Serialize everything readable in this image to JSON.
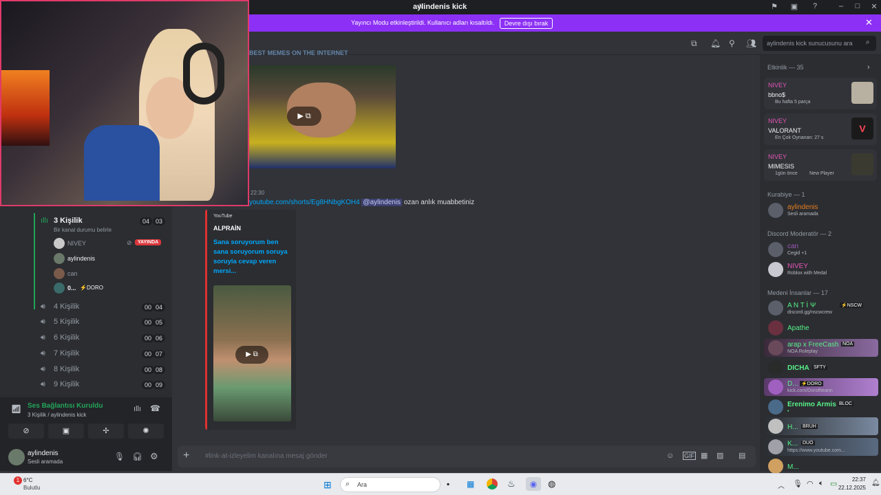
{
  "window": {
    "title": "aylindenis kick"
  },
  "banner": {
    "text": "Yayıncı Modu etkinleştirildi. Kullanıcı adları kısaltıldı.",
    "button": "Devre dışı bırak"
  },
  "header": {
    "search_placeholder": "aylindenis kick sunucusunu ara"
  },
  "chat": {
    "prev_caption": "BEST MEMES ON THE INTERNET",
    "msg_time": "22:30",
    "msg_link": "youtube.com/shorts/Eg8HNbgKOH4",
    "msg_mention": "@aylindenis",
    "msg_text": "ozan anlık muabbetiniz",
    "embed_source": "YouTube",
    "embed_title": "ALPRAİN",
    "embed_desc": "Sana soruyorum ben sana soruyorum soruya soruyla cevap veren mersi...",
    "input_placeholder": "#link-at-izleyelim kanalına mesaj gönder"
  },
  "voice": {
    "active_channel": {
      "name": "3 Kişilik",
      "status_hint": "Bir kanal durumu belirle",
      "c1": "04",
      "c2": "03"
    },
    "users": [
      {
        "name": "NIVEY",
        "badge": "YAYINDA"
      },
      {
        "name": "aylindenis"
      },
      {
        "name": "can"
      },
      {
        "name": "0...",
        "tag": "⚡DORO"
      }
    ],
    "channels": [
      {
        "name": "4 Kişilik",
        "c1": "00",
        "c2": "04"
      },
      {
        "name": "5 Kişilik",
        "c1": "00",
        "c2": "05"
      },
      {
        "name": "6 Kişilik",
        "c1": "00",
        "c2": "06"
      },
      {
        "name": "7 Kişilik",
        "c1": "00",
        "c2": "07"
      },
      {
        "name": "8 Kişilik",
        "c1": "00",
        "c2": "08"
      },
      {
        "name": "9 Kişilik",
        "c1": "00",
        "c2": "09"
      }
    ],
    "connection": {
      "status": "Ses Bağlantısı Kuruldu",
      "detail": "3 Kişilik / aylindenis kick"
    },
    "user": {
      "name": "aylindenis",
      "status": "Sesli aramada"
    }
  },
  "members": {
    "activity_header": "Etkinlik — 35",
    "activities": [
      {
        "user": "NIVEY",
        "title": "bbno$",
        "sub": "Bu hafta 5 parça"
      },
      {
        "user": "NIVEY",
        "title": "VALORANT",
        "sub": "En Çok Oynanan: 27 s"
      },
      {
        "user": "NIVEY",
        "title": "MIMESIS",
        "sub": "1gün önce",
        "extra": "New Player"
      }
    ],
    "kurabiye_header": "Kurabiye — 1",
    "kurabiye": [
      {
        "name": "aylindenis",
        "sub": "Sesli aramada",
        "color": "#e67e22"
      }
    ],
    "mod_header": "Discord Moderatör — 2",
    "mods": [
      {
        "name": "can",
        "sub": "Cegid +1",
        "color": "#9b59b6"
      },
      {
        "name": "NIVEY",
        "sub": "Roblox with Medal",
        "color": "#e755b8"
      }
    ],
    "medeni_header": "Medeni İnsanlar — 17",
    "medeni": [
      {
        "name": "A N T İ Ψ",
        "tag": "⚡NSCW",
        "sub": "discord.gg/nscwcrew",
        "color": "#57f287"
      },
      {
        "name": "Apathe",
        "tag": "",
        "sub": "",
        "color": "#57f287"
      },
      {
        "name": "arap x FreeCash",
        "tag": "NOA",
        "sub": "NOA Roleplay",
        "color": "#57f287"
      },
      {
        "name": "DICHA",
        "tag": "SFTY",
        "sub": "",
        "color": "#57f287"
      },
      {
        "name": "D...",
        "tag": "⚡DORO",
        "sub": "kick.com/Dorotheann",
        "color": "#57f287"
      },
      {
        "name": "Erenimo Armis",
        "tag": "BLOC",
        "sub": "•",
        "color": "#57f287"
      },
      {
        "name": "H...",
        "tag": "BRUH",
        "sub": "",
        "color": "#57f287"
      },
      {
        "name": "K...",
        "tag": "DUO",
        "sub": "https://www.youtube.com...",
        "color": "#57f287"
      },
      {
        "name": "M...",
        "tag": "",
        "sub": "",
        "color": "#57f287"
      }
    ]
  },
  "taskbar": {
    "temp": "6°C",
    "weather": "Bulutlu",
    "search": "Ara",
    "time": "22:37",
    "date": "22.12.2025",
    "notif": "1"
  }
}
